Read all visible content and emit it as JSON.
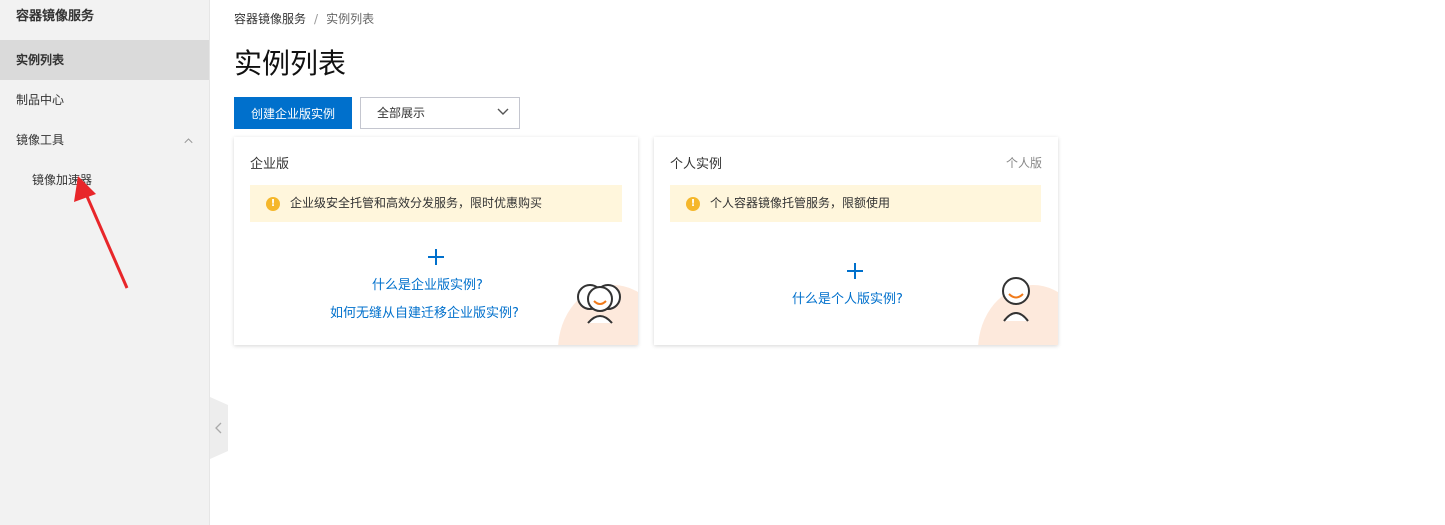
{
  "sidebar": {
    "title": "容器镜像服务",
    "items": [
      {
        "label": "实例列表"
      },
      {
        "label": "制品中心"
      },
      {
        "label": "镜像工具"
      },
      {
        "label": "镜像加速器"
      }
    ]
  },
  "breadcrumb": {
    "root": "容器镜像服务",
    "separator": "/",
    "current": "实例列表"
  },
  "page": {
    "title": "实例列表",
    "create_button": "创建企业版实例",
    "filter_select": "全部展示"
  },
  "cards": {
    "enterprise": {
      "title": "企业版",
      "notice": "企业级安全托管和高效分发服务，限时优惠购买",
      "link1": "什么是企业版实例?",
      "link2": "如何无缝从自建迁移企业版实例?"
    },
    "personal": {
      "title": "个人实例",
      "tag": "个人版",
      "notice": "个人容器镜像托管服务，限额使用",
      "link1": "什么是个人版实例?"
    }
  },
  "colors": {
    "primary": "#0070cc",
    "notice_bg": "#fff6dc",
    "notice_icon": "#f5b72b",
    "sidebar_bg": "#f2f2f2",
    "annotation_arrow": "#e8262a"
  }
}
